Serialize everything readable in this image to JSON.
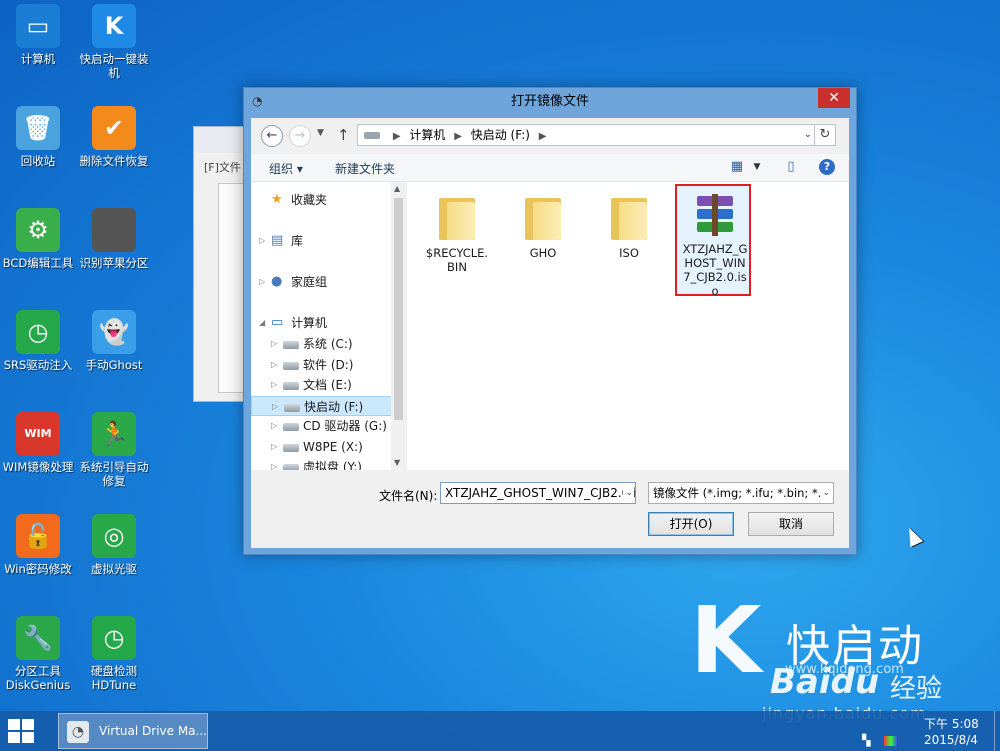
{
  "desktop": {
    "icons": [
      {
        "label": "计算机",
        "icon": "computer-icon",
        "glyph": "▭",
        "color": "#1a7fd4"
      },
      {
        "label": "快启动一键装机",
        "icon": "kqd-install-icon",
        "glyph": "K",
        "color": "#1e8ae6"
      },
      {
        "label": "回收站",
        "icon": "recycle-bin-icon",
        "glyph": "🗑",
        "color": "#4aa3df"
      },
      {
        "label": "删除文件恢复",
        "icon": "file-recovery-icon",
        "glyph": "✔",
        "color": "#f28a1c"
      },
      {
        "label": "BCD编辑工具",
        "icon": "bcd-gear-icon",
        "glyph": "⚙",
        "color": "#3aae4a"
      },
      {
        "label": "识别苹果分区",
        "icon": "apple-icon",
        "glyph": "",
        "color": "#555555"
      },
      {
        "label": "SRS驱动注入",
        "icon": "srs-clock-icon",
        "glyph": "◷",
        "color": "#24a84a"
      },
      {
        "label": "手动Ghost",
        "icon": "ghost-icon",
        "glyph": "👻",
        "color": "#3a9ee8"
      },
      {
        "label": "WIM镜像处理",
        "icon": "wim-icon",
        "glyph": "WIM",
        "color": "#d9362c"
      },
      {
        "label": "系统引导自动修复",
        "icon": "boot-repair-icon",
        "glyph": "🏃",
        "color": "#2aa84a"
      },
      {
        "label": "Win密码修改",
        "icon": "password-lock-icon",
        "glyph": "🔓",
        "color": "#f26a1c"
      },
      {
        "label": "虚拟光驱",
        "icon": "virtual-disc-icon",
        "glyph": "◎",
        "color": "#29a84a"
      },
      {
        "label": "分区工具DiskGenius",
        "icon": "diskgenius-wrench-icon",
        "glyph": "🔧",
        "color": "#2aa84a"
      },
      {
        "label": "硬盘检测HDTune",
        "icon": "hdtune-icon",
        "glyph": "◷",
        "color": "#24a84a"
      }
    ]
  },
  "watermark": {
    "k": "K",
    "name": "快启动",
    "url": "www.kqidong.com",
    "baidu": "Baidu",
    "baidu_cn": "经验",
    "jingyan": "jingyan.baidu.com"
  },
  "back_window": {
    "tab": "[F]文件"
  },
  "dialog": {
    "title": "打开镜像文件",
    "close": "✕",
    "address": {
      "root": "计算机",
      "current": "快启动 (F:)"
    },
    "toolbar": {
      "organize": "组织 ▾",
      "new_folder": "新建文件夹"
    },
    "nav": [
      {
        "label": "收藏夹",
        "icon": "favorites-star-icon",
        "glyph": "★",
        "level": 0,
        "arrow": ""
      },
      {
        "label": "库",
        "icon": "library-icon",
        "glyph": "▤",
        "level": 0,
        "arrow": "▷"
      },
      {
        "label": "家庭组",
        "icon": "homegroup-icon",
        "glyph": "●",
        "level": 0,
        "arrow": "▷"
      },
      {
        "label": "计算机",
        "icon": "computer-icon",
        "glyph": "▭",
        "level": 0,
        "arrow": "◢"
      },
      {
        "label": "系统 (C:)",
        "icon": "drive-icon",
        "level": 1,
        "arrow": "▷"
      },
      {
        "label": "软件 (D:)",
        "icon": "drive-icon",
        "level": 1,
        "arrow": "▷"
      },
      {
        "label": "文档 (E:)",
        "icon": "drive-icon",
        "level": 1,
        "arrow": "▷"
      },
      {
        "label": "快启动 (F:)",
        "icon": "drive-icon",
        "level": 1,
        "arrow": "▷",
        "selected": true
      },
      {
        "label": "CD 驱动器 (G:)",
        "icon": "cd-drive-icon",
        "level": 1,
        "arrow": "▷"
      },
      {
        "label": "W8PE (X:)",
        "icon": "drive-icon",
        "level": 1,
        "arrow": "▷"
      },
      {
        "label": "虚拟盘 (Y:)",
        "icon": "drive-icon",
        "level": 1,
        "arrow": "▷"
      }
    ],
    "files": [
      {
        "name": "$RECYCLE.BIN",
        "type": "folder"
      },
      {
        "name": "GHO",
        "type": "folder"
      },
      {
        "name": "ISO",
        "type": "folder"
      },
      {
        "name": "XTZJAHZ_GHOST_WIN7_CJB2.0.iso",
        "type": "iso",
        "selected": true
      }
    ],
    "filename_label": "文件名(N):",
    "filename_value": "XTZJAHZ_GHOST_WIN7_CJB2.0.iso",
    "filetype_value": "镜像文件 (*.img; *.ifu; *.bin; *.",
    "open_label": "打开(O)",
    "cancel_label": "取消"
  },
  "taskbar": {
    "task": "Virtual Drive Ma...",
    "time": "下午 5:08",
    "date": "2015/8/4"
  }
}
